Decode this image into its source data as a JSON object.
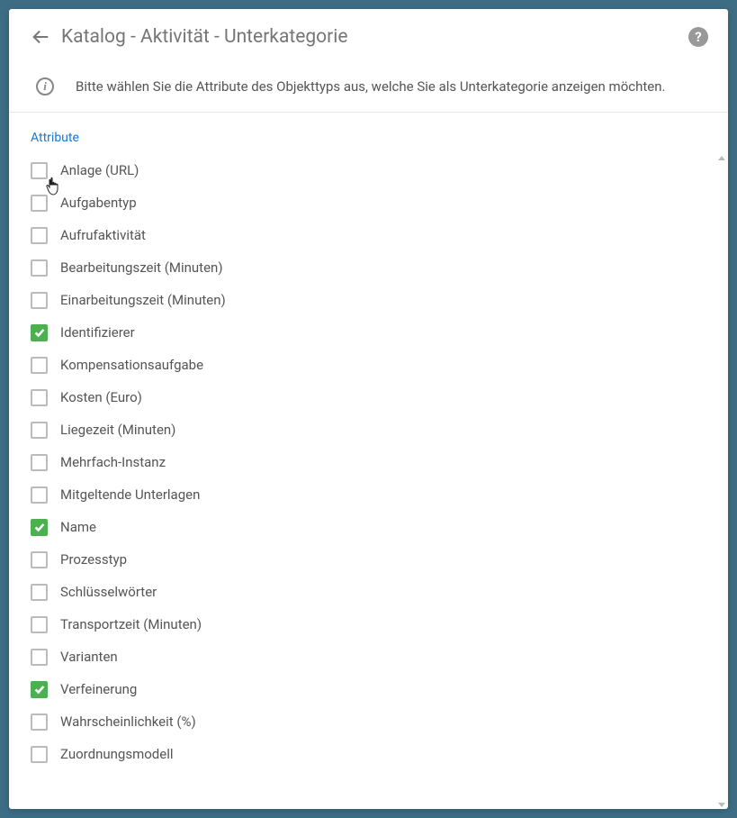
{
  "header": {
    "title": "Katalog - Aktivität - Unterkategorie"
  },
  "info": {
    "text": "Bitte wählen Sie die Attribute des Objekttyps aus, welche Sie als Unterkategorie anzeigen möchten."
  },
  "section": {
    "label": "Attribute"
  },
  "attributes": [
    {
      "label": "Anlage (URL)",
      "checked": false
    },
    {
      "label": "Aufgabentyp",
      "checked": false
    },
    {
      "label": "Aufrufaktivität",
      "checked": false
    },
    {
      "label": "Bearbeitungszeit (Minuten)",
      "checked": false
    },
    {
      "label": "Einarbeitungszeit (Minuten)",
      "checked": false
    },
    {
      "label": "Identifizierer",
      "checked": true
    },
    {
      "label": "Kompensationsaufgabe",
      "checked": false
    },
    {
      "label": "Kosten (Euro)",
      "checked": false
    },
    {
      "label": "Liegezeit (Minuten)",
      "checked": false
    },
    {
      "label": "Mehrfach-Instanz",
      "checked": false
    },
    {
      "label": "Mitgeltende Unterlagen",
      "checked": false
    },
    {
      "label": "Name",
      "checked": true
    },
    {
      "label": "Prozesstyp",
      "checked": false
    },
    {
      "label": "Schlüsselwörter",
      "checked": false
    },
    {
      "label": "Transportzeit (Minuten)",
      "checked": false
    },
    {
      "label": "Varianten",
      "checked": false
    },
    {
      "label": "Verfeinerung",
      "checked": true
    },
    {
      "label": "Wahrscheinlichkeit (%)",
      "checked": false
    },
    {
      "label": "Zuordnungsmodell",
      "checked": false
    }
  ]
}
